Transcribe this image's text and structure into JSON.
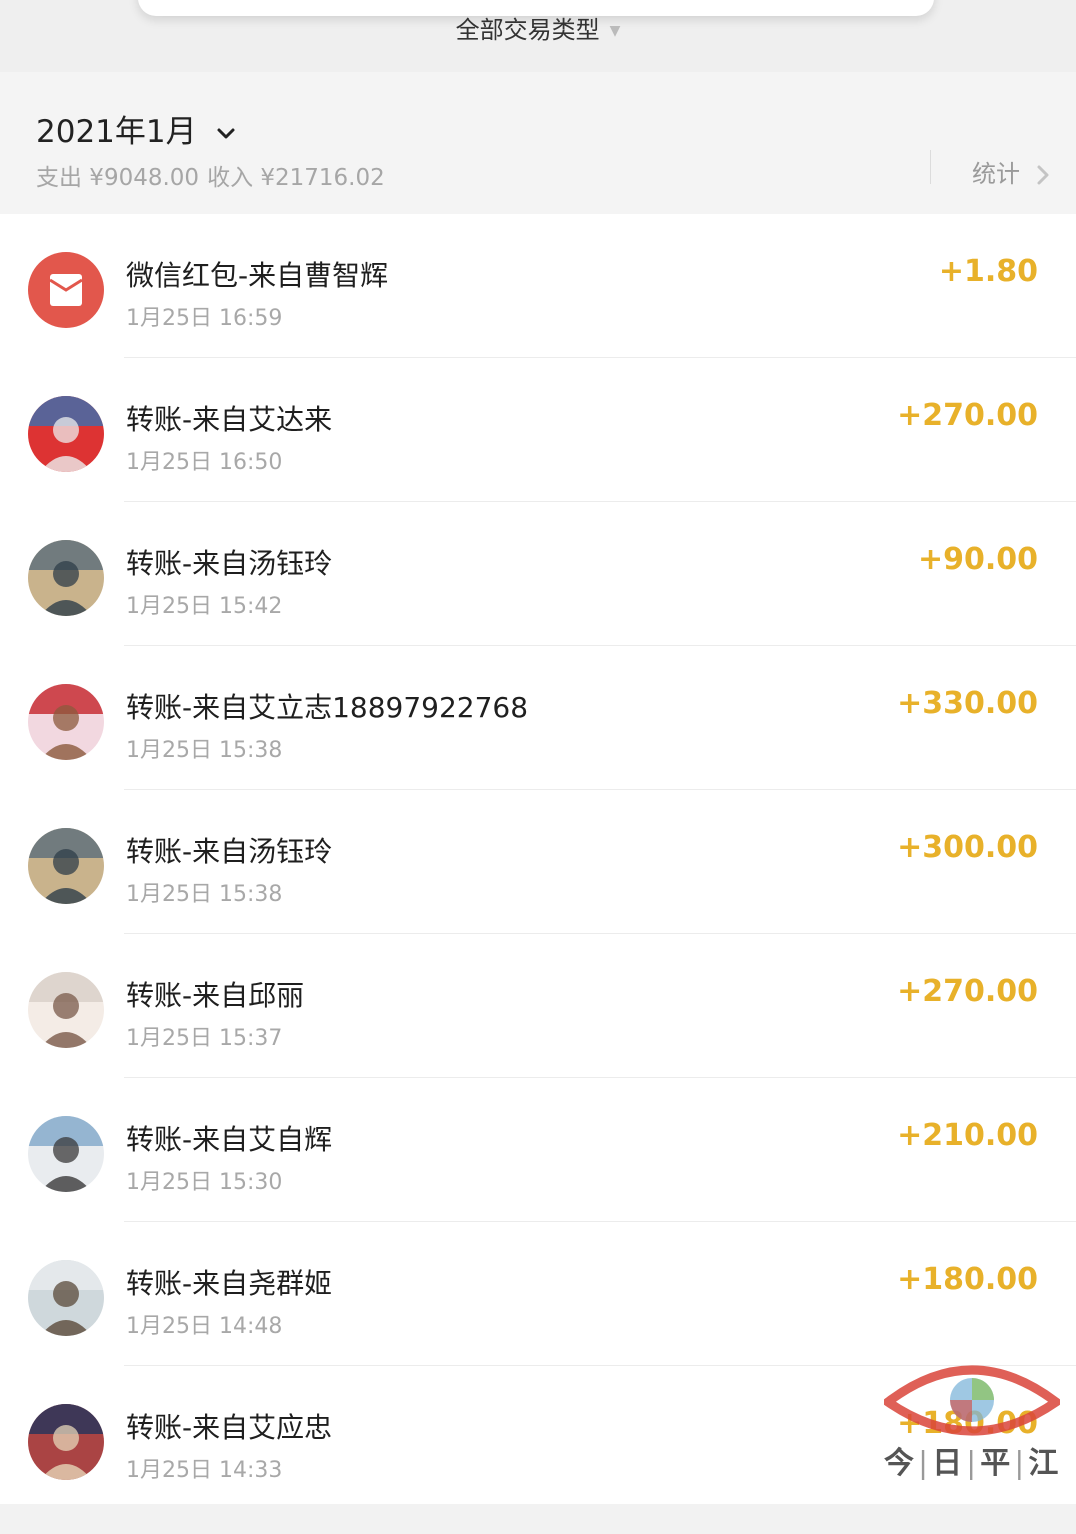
{
  "filter": {
    "label": "全部交易类型"
  },
  "summary": {
    "month": "2021年1月",
    "expense": "支出 ¥9048.00",
    "income": "收入 ¥21716.02",
    "stats_label": "统计"
  },
  "colors": {
    "amount": "#e8b12a",
    "red_packet": "#e2574c"
  },
  "transactions": [
    {
      "title": "微信红包-来自曹智辉",
      "time": "1月25日 16:59",
      "amount": "+1.80",
      "avatar": "red-packet-icon"
    },
    {
      "title": "转账-来自艾达来",
      "time": "1月25日 16:50",
      "amount": "+270.00",
      "avatar": "user-avatar"
    },
    {
      "title": "转账-来自汤钰玲",
      "time": "1月25日 15:42",
      "amount": "+90.00",
      "avatar": "user-avatar"
    },
    {
      "title": "转账-来自艾立志18897922768",
      "time": "1月25日 15:38",
      "amount": "+330.00",
      "avatar": "user-avatar"
    },
    {
      "title": "转账-来自汤钰玲",
      "time": "1月25日 15:38",
      "amount": "+300.00",
      "avatar": "user-avatar"
    },
    {
      "title": "转账-来自邱丽",
      "time": "1月25日 15:37",
      "amount": "+270.00",
      "avatar": "user-avatar"
    },
    {
      "title": "转账-来自艾自辉",
      "time": "1月25日 15:30",
      "amount": "+210.00",
      "avatar": "user-avatar"
    },
    {
      "title": "转账-来自尧群姬",
      "time": "1月25日 14:48",
      "amount": "+180.00",
      "avatar": "user-avatar"
    },
    {
      "title": "转账-来自艾应忠",
      "time": "1月25日 14:33",
      "amount": "+180.00",
      "avatar": "user-avatar"
    }
  ],
  "watermark": {
    "chars": [
      "今",
      "日",
      "平",
      "江"
    ]
  }
}
